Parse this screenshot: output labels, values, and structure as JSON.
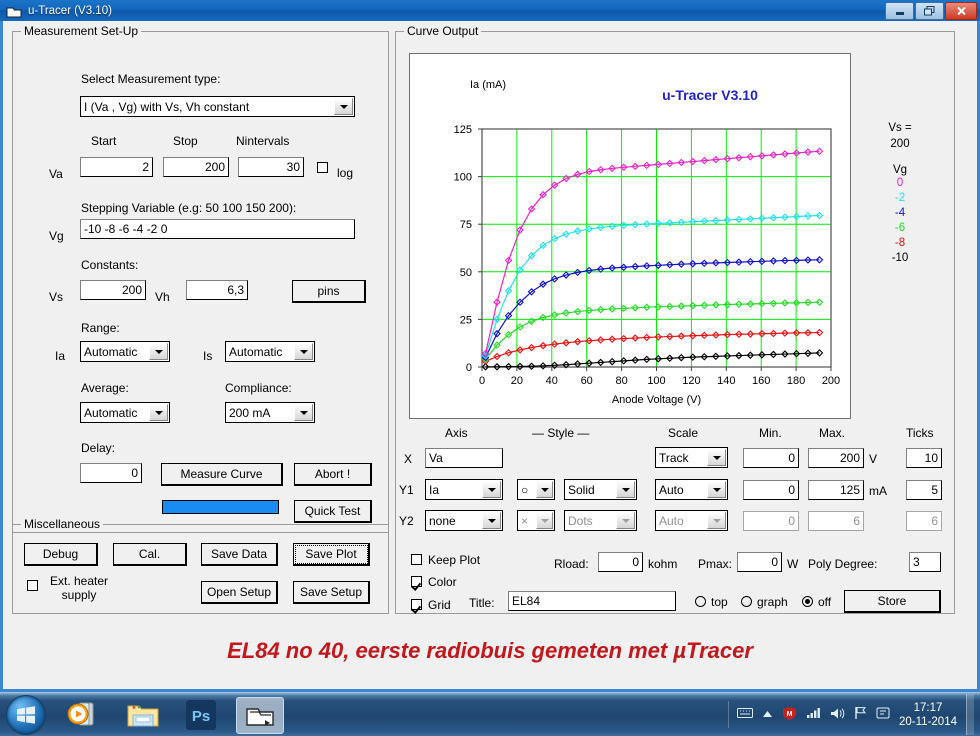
{
  "window": {
    "title": "u-Tracer (V3.10)",
    "icon": "window-app-icon",
    "minimize": "—",
    "maximize": "❐",
    "close": "✕"
  },
  "measurement": {
    "group_label": "Measurement Set-Up",
    "select_label": "Select Measurement type:",
    "measurement_type": "I (Va , Vg) with Vs, Vh constant",
    "headers": {
      "start": "Start",
      "stop": "Stop",
      "nintervals": "Nintervals"
    },
    "va_label": "Va",
    "va_start": "2",
    "va_stop": "200",
    "va_nintervals": "30",
    "log_label": "log",
    "log_checked": false,
    "stepping_label": "Stepping Variable (e.g: 50 100 150 200):",
    "vg_label": "Vg",
    "vg_value": "-10 -8 -6 -4 -2 0",
    "constants_label": "Constants:",
    "vs_label": "Vs",
    "vs_value": "200",
    "vh_label": "Vh",
    "vh_value": "6,3",
    "pins_button": "pins",
    "range_label": "Range:",
    "ia_label": "Ia",
    "ia_range": "Automatic",
    "is_label": "Is",
    "is_range": "Automatic",
    "average_label": "Average:",
    "average_value": "Automatic",
    "compliance_label": "Compliance:",
    "compliance_value": "200 mA",
    "delay_label": "Delay:",
    "delay_value": "0",
    "measure_button": "Measure Curve",
    "abort_button": "Abort !",
    "quick_test_button": "Quick Test",
    "progress_percent": 100
  },
  "miscellaneous": {
    "group_label": "Miscellaneous",
    "debug_button": "Debug",
    "cal_button": "Cal.",
    "save_data_button": "Save Data",
    "save_plot_button": "Save Plot",
    "ext_heater_label_line1": "Ext. heater",
    "ext_heater_label_line2": "supply",
    "ext_heater_checked": false,
    "open_setup_button": "Open Setup",
    "save_setup_button": "Save Setup"
  },
  "curve_output": {
    "group_label": "Curve Output",
    "table_headers": {
      "axis": "Axis",
      "style": "— Style —",
      "scale": "Scale",
      "min": "Min.",
      "max": "Max.",
      "ticks": "Ticks"
    },
    "rows": [
      {
        "name": "X",
        "axis": "Va",
        "marker": "",
        "line": "",
        "scale": "Track",
        "min": "0",
        "max": "200",
        "unit": "V",
        "ticks": "10",
        "enabled": true,
        "has_axis_arrow": false,
        "has_style": false
      },
      {
        "name": "Y1",
        "axis": "Ia",
        "marker": "○",
        "line": "Solid",
        "scale": "Auto",
        "min": "0",
        "max": "125",
        "unit": "mA",
        "ticks": "5",
        "enabled": true,
        "has_axis_arrow": true,
        "has_style": true
      },
      {
        "name": "Y2",
        "axis": "none",
        "marker": "×",
        "line": "Dots",
        "scale": "Auto",
        "min": "0",
        "max": "6",
        "unit": "",
        "ticks": "6",
        "enabled": false,
        "has_axis_arrow": true,
        "has_style": true
      }
    ],
    "keep_plot_label": "Keep Plot",
    "keep_plot_checked": false,
    "color_label": "Color",
    "color_checked": true,
    "grid_label": "Grid",
    "grid_checked": true,
    "rload_label": "Rload:",
    "rload_value": "0",
    "rload_unit": "kohm",
    "pmax_label": "Pmax:",
    "pmax_value": "0",
    "pmax_unit": "W",
    "poly_label": "Poly Degree:",
    "poly_value": "3",
    "title_label": "Title:",
    "title_value": "EL84",
    "radio_top": "top",
    "radio_graph": "graph",
    "radio_off": "off",
    "radio_selected": "off",
    "store_button": "Store"
  },
  "caption": "EL84 no 40, eerste radiobuis gemeten met µTracer",
  "taskbar": {
    "start": "start-orb",
    "items": [
      {
        "name": "media-player-icon",
        "active": false
      },
      {
        "name": "windows-explorer-icon",
        "active": false
      },
      {
        "name": "photoshop-icon",
        "active": false
      },
      {
        "name": "utracer-window-icon",
        "active": true
      }
    ],
    "tray": [
      "keyboard-icon",
      "show-hidden-icons-icon",
      "mcafee-icon",
      "network-icon",
      "volume-icon",
      "action-flag-icon",
      "device-icon"
    ],
    "time": "17:17",
    "date": "20-11-2014"
  },
  "chart_data": {
    "type": "line",
    "title": "u-Tracer V3.10",
    "title_color": "#2222cc",
    "ylabel": "Ia (mA)",
    "xlabel": "Anode Voltage (V)",
    "xlim": [
      0,
      200
    ],
    "ylim": [
      0,
      125
    ],
    "xticks": [
      0,
      20,
      40,
      60,
      80,
      100,
      120,
      140,
      160,
      180,
      200
    ],
    "yticks": [
      0,
      25,
      50,
      75,
      100,
      125
    ],
    "grid": true,
    "grid_color": "#00ee00",
    "marker": "diamond",
    "legend_position": "right",
    "legend_heading_vs": "Vs =",
    "legend_vs_value": "200",
    "legend_heading_vg": "Vg",
    "series": [
      {
        "name": "-10",
        "color": "#000000",
        "x": [
          2,
          8.6,
          15.2,
          21.8,
          28.4,
          35,
          41.6,
          48.2,
          54.8,
          61.4,
          68,
          74.6,
          81.2,
          87.8,
          94.4,
          101,
          107.6,
          114.2,
          120.8,
          127.4,
          134,
          140.6,
          147.2,
          153.8,
          160.4,
          167,
          173.6,
          180.2,
          186.8,
          193.4
        ],
        "y": [
          0.1,
          0.1,
          0.2,
          0.3,
          0.4,
          0.6,
          0.9,
          1.2,
          1.6,
          2.0,
          2.4,
          2.8,
          3.2,
          3.6,
          4.0,
          4.3,
          4.6,
          4.9,
          5.2,
          5.4,
          5.6,
          5.8,
          6.0,
          6.2,
          6.4,
          6.6,
          6.8,
          7.0,
          7.2,
          7.4
        ]
      },
      {
        "name": "-8",
        "color": "#ee1111",
        "x": [
          2,
          8.6,
          15.2,
          21.8,
          28.4,
          35,
          41.6,
          48.2,
          54.8,
          61.4,
          68,
          74.6,
          81.2,
          87.8,
          94.4,
          101,
          107.6,
          114.2,
          120.8,
          127.4,
          134,
          140.6,
          147.2,
          153.8,
          160.4,
          167,
          173.6,
          180.2,
          186.8,
          193.4
        ],
        "y": [
          3.0,
          5.5,
          7.5,
          9.0,
          10.2,
          11.2,
          12.0,
          12.7,
          13.3,
          13.8,
          14.2,
          14.6,
          14.9,
          15.2,
          15.5,
          15.8,
          16.0,
          16.2,
          16.4,
          16.6,
          16.8,
          17.0,
          17.2,
          17.3,
          17.5,
          17.6,
          17.8,
          17.9,
          18.0,
          18.1
        ]
      },
      {
        "name": "-6",
        "color": "#22dd22",
        "x": [
          2,
          8.6,
          15.2,
          21.8,
          28.4,
          35,
          41.6,
          48.2,
          54.8,
          61.4,
          68,
          74.6,
          81.2,
          87.8,
          94.4,
          101,
          107.6,
          114.2,
          120.8,
          127.4,
          134,
          140.6,
          147.2,
          153.8,
          160.4,
          167,
          173.6,
          180.2,
          186.8,
          193.4
        ],
        "y": [
          4.0,
          11.5,
          17.0,
          21.0,
          24.0,
          26.0,
          27.4,
          28.4,
          29.1,
          29.7,
          30.1,
          30.5,
          30.8,
          31.1,
          31.4,
          31.6,
          31.8,
          32.0,
          32.2,
          32.4,
          32.6,
          32.8,
          33.0,
          33.1,
          33.3,
          33.4,
          33.6,
          33.7,
          33.9,
          34.0
        ]
      },
      {
        "name": "-4",
        "color": "#1111cc",
        "x": [
          2,
          8.6,
          15.2,
          21.8,
          28.4,
          35,
          41.6,
          48.2,
          54.8,
          61.4,
          68,
          74.6,
          81.2,
          87.8,
          94.4,
          101,
          107.6,
          114.2,
          120.8,
          127.4,
          134,
          140.6,
          147.2,
          153.8,
          160.4,
          167,
          173.6,
          180.2,
          186.8,
          193.4
        ],
        "y": [
          5.0,
          17.5,
          27.0,
          34.0,
          39.5,
          43.5,
          46.3,
          48.3,
          49.7,
          50.7,
          51.4,
          52.0,
          52.4,
          52.8,
          53.1,
          53.4,
          53.7,
          54.0,
          54.2,
          54.5,
          54.7,
          54.9,
          55.1,
          55.3,
          55.5,
          55.7,
          55.9,
          56.0,
          56.2,
          56.3
        ]
      },
      {
        "name": "-2",
        "color": "#22e0ee",
        "x": [
          2,
          8.6,
          15.2,
          21.8,
          28.4,
          35,
          41.6,
          48.2,
          54.8,
          61.4,
          68,
          74.6,
          81.2,
          87.8,
          94.4,
          101,
          107.6,
          114.2,
          120.8,
          127.4,
          134,
          140.6,
          147.2,
          153.8,
          160.4,
          167,
          173.6,
          180.2,
          186.8,
          193.4
        ],
        "y": [
          6.0,
          25.0,
          40.0,
          51.0,
          58.5,
          63.8,
          67.4,
          69.8,
          71.4,
          72.5,
          73.3,
          73.9,
          74.4,
          74.8,
          75.1,
          75.4,
          75.7,
          76.0,
          76.3,
          76.6,
          76.9,
          77.2,
          77.5,
          77.8,
          78.1,
          78.4,
          78.7,
          79.0,
          79.3,
          79.6
        ]
      },
      {
        "name": "0",
        "color": "#ee22cc",
        "x": [
          2,
          8.6,
          15.2,
          21.8,
          28.4,
          35,
          41.6,
          48.2,
          54.8,
          61.4,
          68,
          74.6,
          81.2,
          87.8,
          94.4,
          101,
          107.6,
          114.2,
          120.8,
          127.4,
          134,
          140.6,
          147.2,
          153.8,
          160.4,
          167,
          173.6,
          180.2,
          186.8,
          193.4
        ],
        "y": [
          7.0,
          34.0,
          56.0,
          72.0,
          83.0,
          90.5,
          95.5,
          99.0,
          101.2,
          102.6,
          103.6,
          104.3,
          104.9,
          105.4,
          105.9,
          106.4,
          106.9,
          107.4,
          107.9,
          108.4,
          108.9,
          109.4,
          109.9,
          110.4,
          110.9,
          111.4,
          111.9,
          112.4,
          112.9,
          113.3
        ]
      }
    ]
  }
}
